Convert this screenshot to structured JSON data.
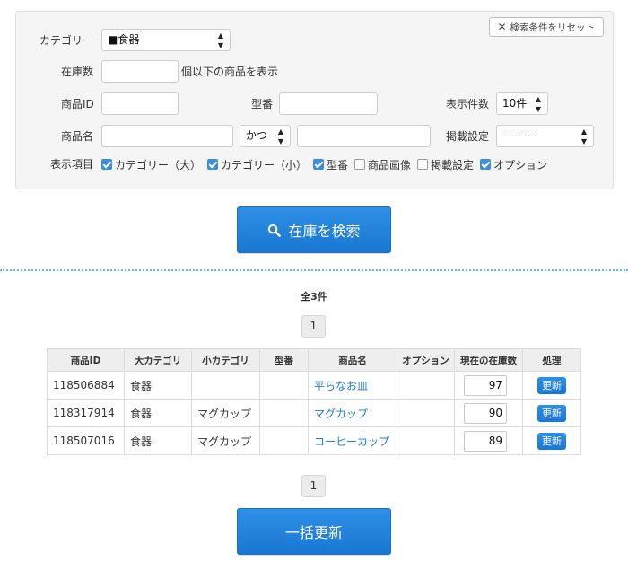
{
  "filters": {
    "reset_label": "検索条件をリセット",
    "category": {
      "label": "カテゴリー",
      "value": "■食器"
    },
    "stock": {
      "label": "在庫数",
      "value": "",
      "suffix": "個以下の商品を表示"
    },
    "product_id": {
      "label": "商品ID",
      "value": ""
    },
    "model_no": {
      "label": "型番",
      "value": ""
    },
    "display_count": {
      "label": "表示件数",
      "value": "10件"
    },
    "product_name": {
      "label": "商品名",
      "value": "",
      "mode": "かつ",
      "value2": ""
    },
    "listing": {
      "label": "掲載設定",
      "value": "---------"
    },
    "columns": {
      "label": "表示項目",
      "items": [
        {
          "label": "カテゴリー（大）",
          "checked": true
        },
        {
          "label": "カテゴリー（小）",
          "checked": true
        },
        {
          "label": "型番",
          "checked": true
        },
        {
          "label": "商品画像",
          "checked": false
        },
        {
          "label": "掲載設定",
          "checked": false
        },
        {
          "label": "オプション",
          "checked": true
        }
      ]
    }
  },
  "search_button": {
    "label": "在庫を検索"
  },
  "results": {
    "count_text": "全3件",
    "page": "1",
    "columns": [
      "商品ID",
      "大カテゴリ",
      "小カテゴリ",
      "型番",
      "商品名",
      "オプション",
      "現在の在庫数",
      "処理"
    ],
    "rows": [
      {
        "id": "118506884",
        "cat_large": "食器",
        "cat_small": "",
        "model": "",
        "name": "平らなお皿",
        "option": "",
        "stock": "97",
        "action": "更新"
      },
      {
        "id": "118317914",
        "cat_large": "食器",
        "cat_small": "マグカップ",
        "model": "",
        "name": "マグカップ",
        "option": "",
        "stock": "90",
        "action": "更新"
      },
      {
        "id": "118507016",
        "cat_large": "食器",
        "cat_small": "マグカップ",
        "model": "",
        "name": "コーヒーカップ",
        "option": "",
        "stock": "89",
        "action": "更新"
      }
    ]
  },
  "bulk_button": {
    "label": "一括更新"
  },
  "colors": {
    "accent": "#1f7bd6",
    "divider": "#69b7e2",
    "panel_bg": "#f5f5f5"
  },
  "icons": {
    "reset": "close-icon",
    "search": "search-icon",
    "select": "up-down-arrows-icon"
  }
}
